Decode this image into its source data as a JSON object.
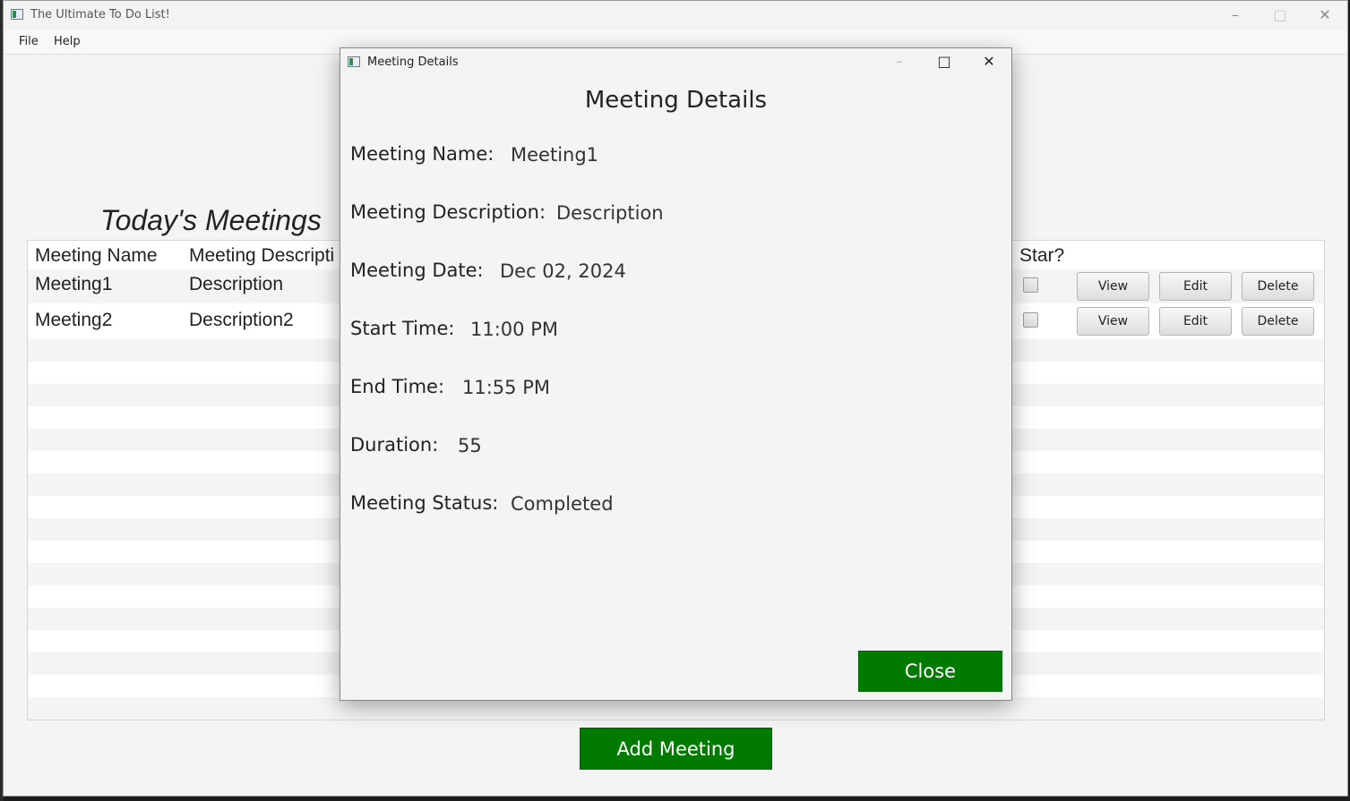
{
  "window": {
    "title": "The Ultimate To Do List!"
  },
  "menu": {
    "items": [
      "File",
      "Help"
    ]
  },
  "page": {
    "heading": "Today's Meetings"
  },
  "table": {
    "headers": {
      "name": "Meeting Name",
      "description": "Meeting Descripti",
      "star": "Star?"
    },
    "rows": [
      {
        "name": "Meeting1",
        "description": "Description",
        "starred": false
      },
      {
        "name": "Meeting2",
        "description": "Description2",
        "starred": false
      }
    ],
    "row_buttons": {
      "view": "View",
      "edit": "Edit",
      "delete": "Delete"
    }
  },
  "add_meeting_label": "Add Meeting",
  "dialog": {
    "title": "Meeting Details",
    "heading": "Meeting Details",
    "fields": {
      "name": {
        "label": "Meeting Name:",
        "value": "Meeting1"
      },
      "description": {
        "label": "Meeting Description:",
        "value": "Description"
      },
      "date": {
        "label": "Meeting Date:",
        "value": "Dec 02, 2024"
      },
      "start": {
        "label": "Start Time:",
        "value": "11:00 PM"
      },
      "end": {
        "label": "End Time:",
        "value": "11:55 PM"
      },
      "duration": {
        "label": "Duration:",
        "value": "55"
      },
      "status": {
        "label": "Meeting Status:",
        "value": "Completed"
      }
    },
    "close_label": "Close"
  },
  "colors": {
    "accent_green": "#007b00",
    "window_bg": "#f4f4f4",
    "stripe": "#f4f4f4"
  },
  "icons": {
    "minimize": "minimize-icon",
    "maximize": "maximize-icon",
    "close": "close-icon"
  }
}
